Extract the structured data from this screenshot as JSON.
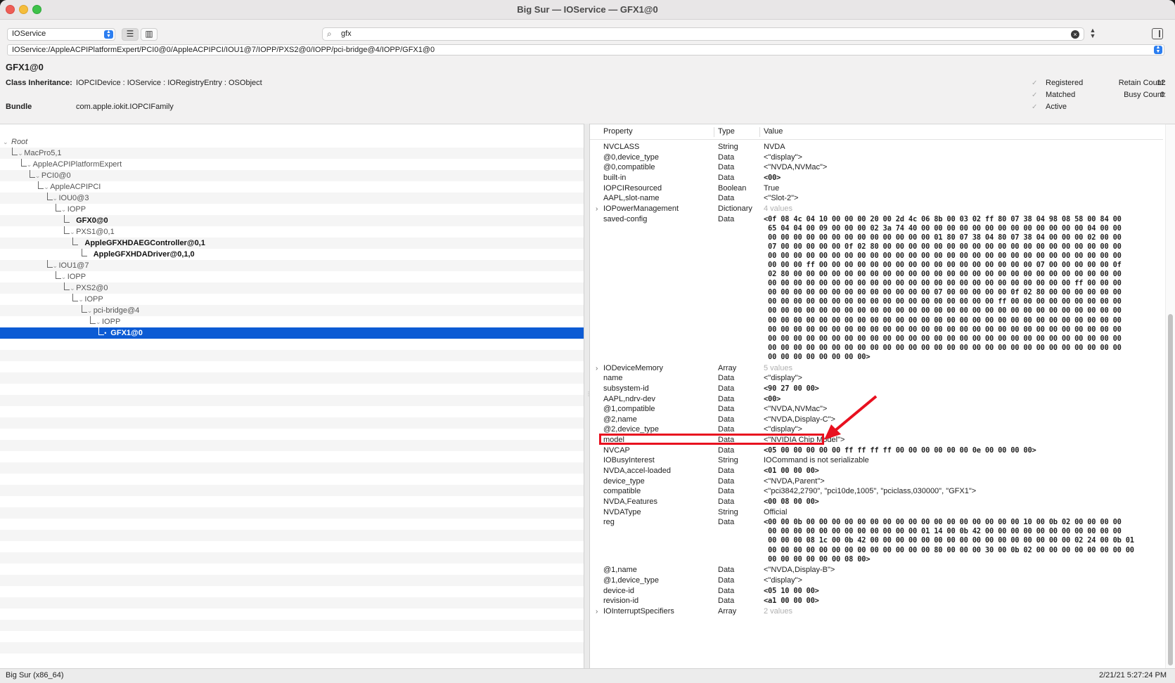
{
  "window": {
    "title": "Big Sur — IOService — GFX1@0"
  },
  "toolbar": {
    "plane": "IOService",
    "search_value": "gfx",
    "path": "IOService:/AppleACPIPlatformExpert/PCI0@0/AppleACPIPCI/IOU1@7/IOPP/PXS2@0/IOPP/pci-bridge@4/IOPP/GFX1@0"
  },
  "info": {
    "object_name": "GFX1@0",
    "class_label": "Class Inheritance:",
    "class_value": "IOPCIDevice : IOService : IORegistryEntry : OSObject",
    "bundle_label": "Bundle",
    "bundle_value": "com.apple.iokit.IOPCIFamily",
    "registered": "Registered",
    "matched": "Matched",
    "active": "Active",
    "retain_label": "Retain Count:",
    "retain_value": "12",
    "busy_label": "Busy Count:",
    "busy_value": "0"
  },
  "tree": [
    {
      "label": "Root",
      "depth": 0,
      "italic": true
    },
    {
      "label": "MacPro5,1",
      "depth": 1
    },
    {
      "label": "AppleACPIPlatformExpert",
      "depth": 2
    },
    {
      "label": "PCI0@0",
      "depth": 3
    },
    {
      "label": "AppleACPIPCI",
      "depth": 4
    },
    {
      "label": "IOU0@3",
      "depth": 5
    },
    {
      "label": "IOPP",
      "depth": 6
    },
    {
      "label": "GFX0@0",
      "depth": 7,
      "bold": true
    },
    {
      "label": "PXS1@0,1",
      "depth": 7
    },
    {
      "label": "AppleGFXHDAEGController@0,1",
      "depth": 8,
      "bold": true
    },
    {
      "label": "AppleGFXHDADriver@0,1,0",
      "depth": 9,
      "bold": true
    },
    {
      "label": "IOU1@7",
      "depth": 5
    },
    {
      "label": "IOPP",
      "depth": 6
    },
    {
      "label": "PXS2@0",
      "depth": 7
    },
    {
      "label": "IOPP",
      "depth": 8
    },
    {
      "label": "pci-bridge@4",
      "depth": 9
    },
    {
      "label": "IOPP",
      "depth": 10
    },
    {
      "label": "GFX1@0",
      "depth": 11,
      "bold": true,
      "selected": true
    }
  ],
  "properties": {
    "headers": {
      "property": "Property",
      "type": "Type",
      "value": "Value"
    },
    "rows": [
      {
        "p": "NVCLASS",
        "t": "String",
        "v": "NVDA"
      },
      {
        "p": "@0,device_type",
        "t": "Data",
        "v": "<\"display\">"
      },
      {
        "p": "@0,compatible",
        "t": "Data",
        "v": "<\"NVDA,NVMac\">"
      },
      {
        "p": "built-in",
        "t": "Data",
        "v": "<00>",
        "mono": true
      },
      {
        "p": "IOPCIResourced",
        "t": "Boolean",
        "v": "True"
      },
      {
        "p": "AAPL,slot-name",
        "t": "Data",
        "v": "<\"Slot-2\">"
      },
      {
        "p": "IOPowerManagement",
        "t": "Dictionary",
        "v": "4 values",
        "dim": true,
        "disc": true
      },
      {
        "p": "saved-config",
        "t": "Data",
        "mono": true,
        "lines": 16,
        "v": "<0f 08 4c 04 10 00 00 00 20 00 2d 4c 06 8b 00 03 02 ff 80 07 38 04 98 08 58 00 84 00\n 65 04 04 00 09 00 00 00 02 3a 74 40 00 00 00 00 00 00 00 00 00 00 00 00 00 04 00 00\n 00 00 00 00 00 00 00 00 00 00 00 00 00 01 80 07 38 04 80 07 38 04 00 00 00 02 00 00\n 07 00 00 00 00 00 0f 02 80 00 00 00 00 00 00 00 00 00 00 00 00 00 00 00 00 00 00 00\n 00 00 00 00 00 00 00 00 00 00 00 00 00 00 00 00 00 00 00 00 00 00 00 00 00 00 00 00\n 00 00 00 ff 00 00 00 00 00 00 00 00 00 00 00 00 00 00 00 00 00 07 00 00 00 00 00 0f\n 02 80 00 00 00 00 00 00 00 00 00 00 00 00 00 00 00 00 00 00 00 00 00 00 00 00 00 00\n 00 00 00 00 00 00 00 00 00 00 00 00 00 00 00 00 00 00 00 00 00 00 00 00 ff 00 00 00\n 00 00 00 00 00 00 00 00 00 00 00 00 00 07 00 00 00 00 00 0f 02 80 00 00 00 00 00 00\n 00 00 00 00 00 00 00 00 00 00 00 00 00 00 00 00 00 00 ff 00 00 00 00 00 00 00 00 00\n 00 00 00 00 00 00 00 00 00 00 00 00 00 00 00 00 00 00 00 00 00 00 00 00 00 00 00 00\n 00 00 00 00 00 00 00 00 00 00 00 00 00 00 00 00 00 00 00 00 00 00 00 00 00 00 00 00\n 00 00 00 00 00 00 00 00 00 00 00 00 00 00 00 00 00 00 00 00 00 00 00 00 00 00 00 00\n 00 00 00 00 00 00 00 00 00 00 00 00 00 00 00 00 00 00 00 00 00 00 00 00 00 00 00 00\n 00 00 00 00 00 00 00 00 00 00 00 00 00 00 00 00 00 00 00 00 00 00 00 00 00 00 00 00\n 00 00 00 00 00 00 00 00>"
      },
      {
        "p": "IODeviceMemory",
        "t": "Array",
        "v": "5 values",
        "dim": true,
        "disc": true
      },
      {
        "p": "name",
        "t": "Data",
        "v": "<\"display\">"
      },
      {
        "p": "subsystem-id",
        "t": "Data",
        "v": "<90 27 00 00>",
        "mono": true
      },
      {
        "p": "AAPL,ndrv-dev",
        "t": "Data",
        "v": "<00>",
        "mono": true
      },
      {
        "p": "@1,compatible",
        "t": "Data",
        "v": "<\"NVDA,NVMac\">"
      },
      {
        "p": "@2,name",
        "t": "Data",
        "v": "<\"NVDA,Display-C\">"
      },
      {
        "p": "@2,device_type",
        "t": "Data",
        "v": "<\"display\">"
      },
      {
        "p": "model",
        "t": "Data",
        "v": "<\"NVIDIA Chip Model\">"
      },
      {
        "p": "NVCAP",
        "t": "Data",
        "v": "<05 00 00 00 00 00 ff ff ff ff 00 00 00 00 00 00 0e 00 00 00 00>",
        "mono": true
      },
      {
        "p": "IOBusyInterest",
        "t": "String",
        "v": "IOCommand is not serializable"
      },
      {
        "p": "NVDA,accel-loaded",
        "t": "Data",
        "v": "<01 00 00 00>",
        "mono": true
      },
      {
        "p": "device_type",
        "t": "Data",
        "v": "<\"NVDA,Parent\">"
      },
      {
        "p": "compatible",
        "t": "Data",
        "v": "<\"pci3842,2790\", \"pci10de,1005\", \"pciclass,030000\", \"GFX1\">"
      },
      {
        "p": "NVDA,Features",
        "t": "Data",
        "v": "<00 08 00 00>",
        "mono": true
      },
      {
        "p": "NVDAType",
        "t": "String",
        "v": "Official"
      },
      {
        "p": "reg",
        "t": "Data",
        "mono": true,
        "lines": 5,
        "v": "<00 00 0b 00 00 00 00 00 00 00 00 00 00 00 00 00 00 00 00 00 10 00 0b 02 00 00 00 00\n 00 00 00 00 00 00 00 00 00 00 00 00 01 14 00 0b 42 00 00 00 00 00 00 00 00 00 00 00\n 00 00 00 08 1c 00 0b 42 00 00 00 00 00 00 00 00 00 00 00 00 00 00 00 00 02 24 00 0b 01\n 00 00 00 00 00 00 00 00 00 00 00 00 00 80 00 00 00 30 00 0b 02 00 00 00 00 00 00 00 00\n 00 00 00 00 00 00 08 00>"
      },
      {
        "p": "@1,name",
        "t": "Data",
        "v": "<\"NVDA,Display-B\">"
      },
      {
        "p": "@1,device_type",
        "t": "Data",
        "v": "<\"display\">"
      },
      {
        "p": "device-id",
        "t": "Data",
        "v": "<05 10 00 00>",
        "mono": true
      },
      {
        "p": "revision-id",
        "t": "Data",
        "v": "<a1 00 00 00>",
        "mono": true
      },
      {
        "p": "IOInterruptSpecifiers",
        "t": "Array",
        "v": "2 values",
        "dim": true,
        "disc": true
      }
    ]
  },
  "status": {
    "left": "Big Sur (x86_64)",
    "right": "2/21/21 5:27:24 PM"
  }
}
